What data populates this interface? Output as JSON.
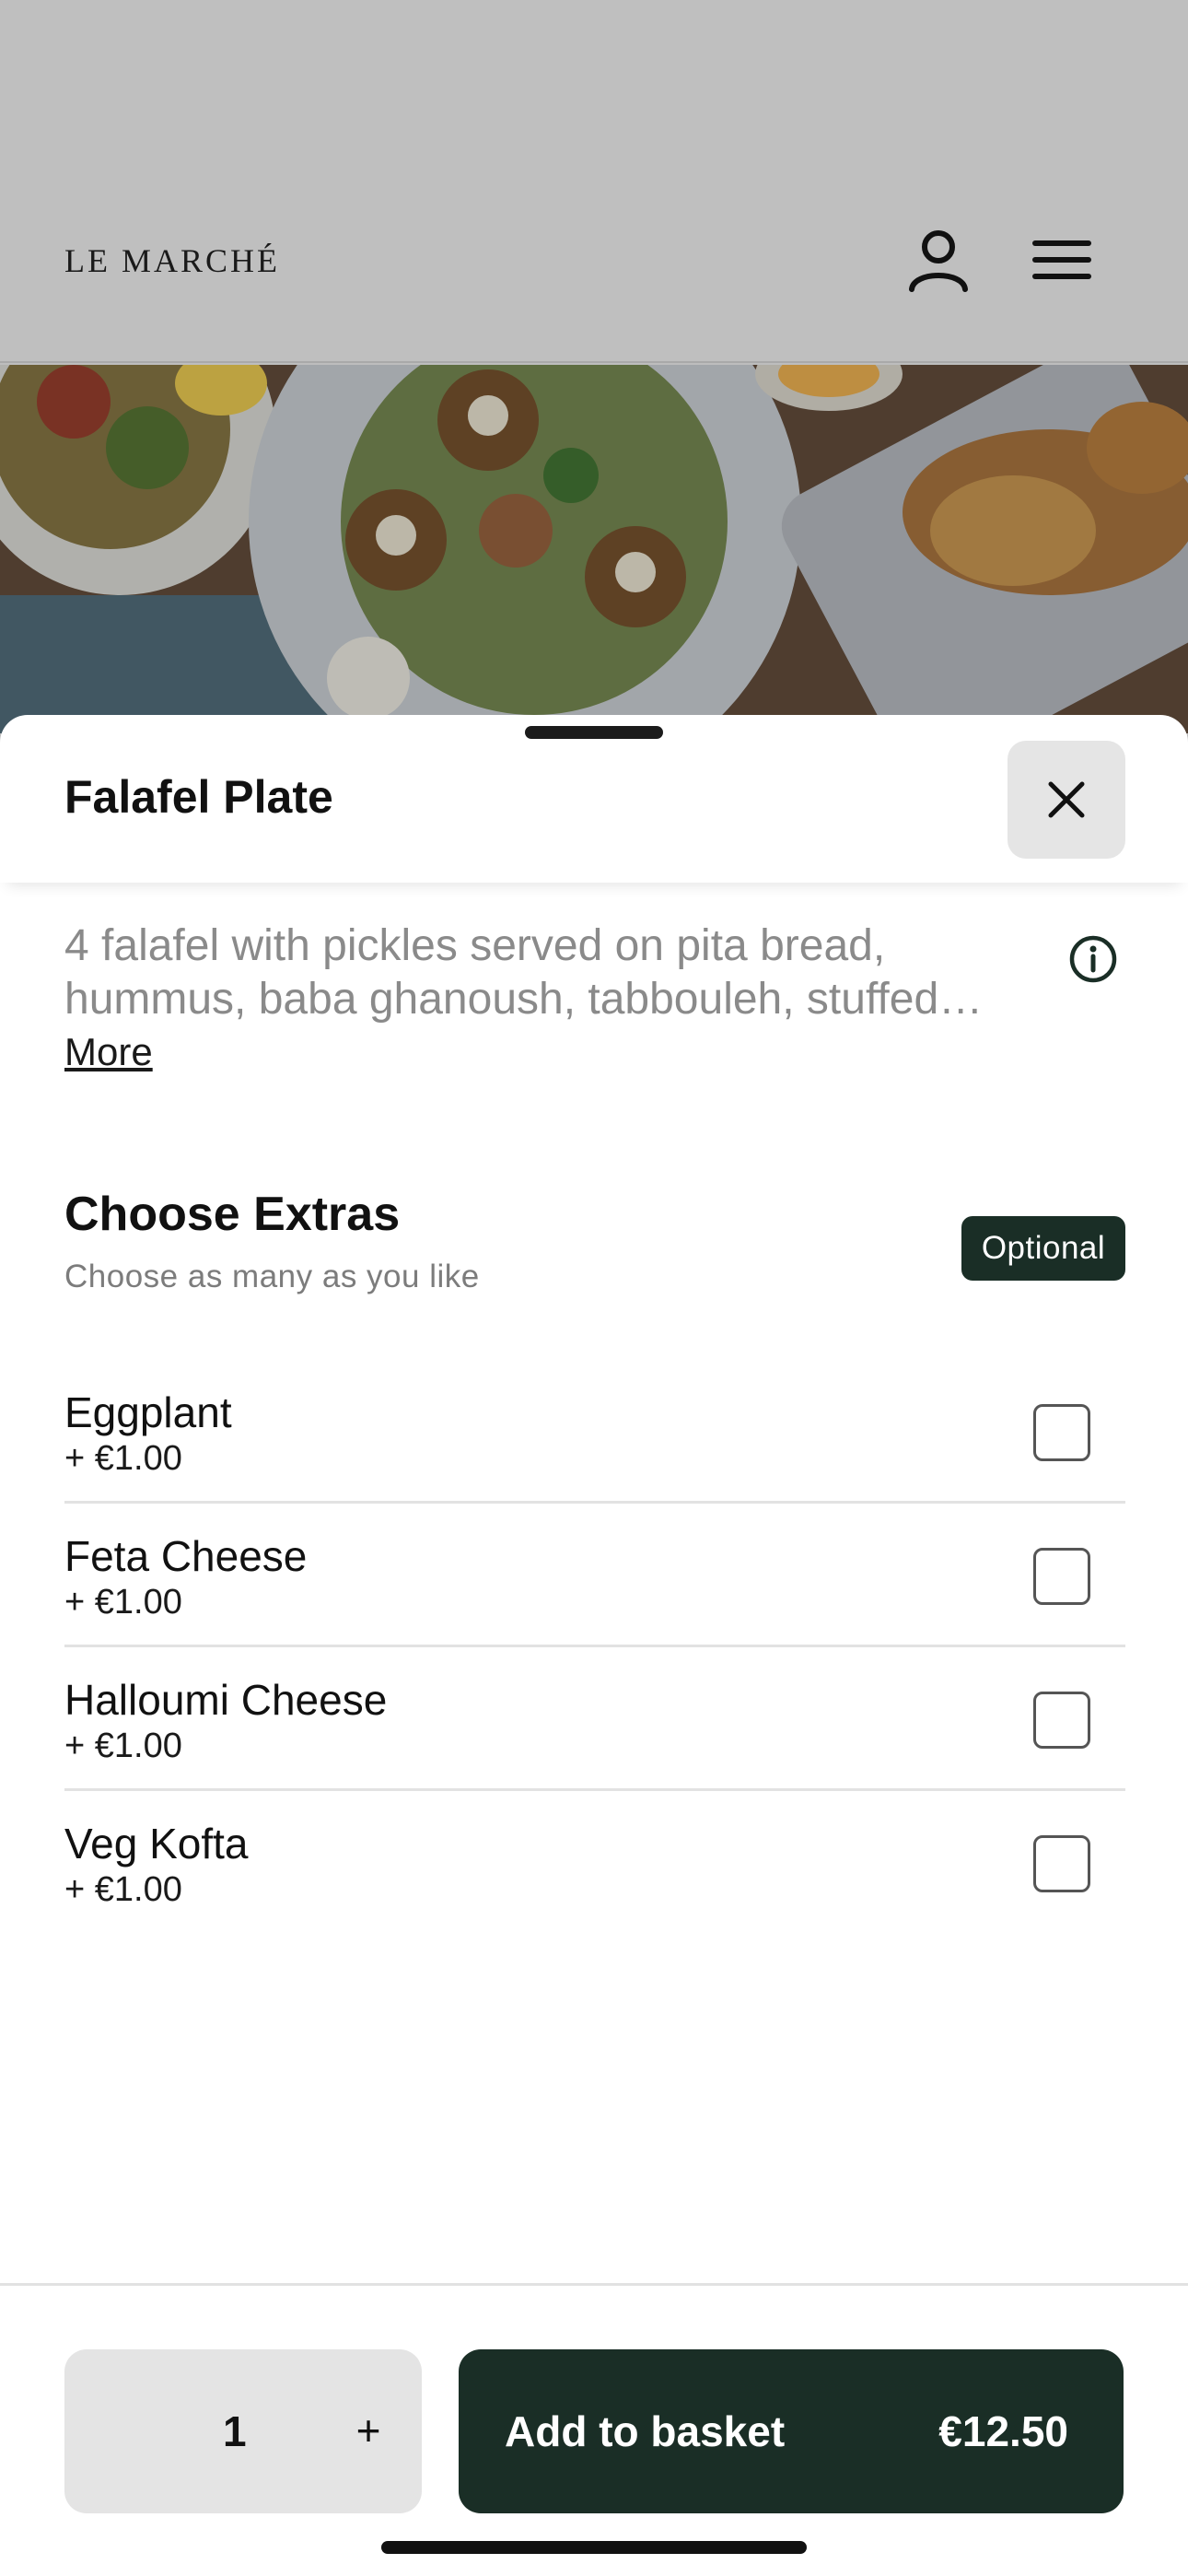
{
  "header": {
    "brand": "LE MARCHÉ",
    "account_icon": "person-icon",
    "menu_icon": "hamburger-menu-icon"
  },
  "hero": {
    "image_description": "food-plates-photo"
  },
  "sheet": {
    "title": "Falafel Plate",
    "close_icon": "close-icon",
    "description": "4 falafel with pickles served on pita bread, hummus, baba ghanoush, tabbouleh, stuffed…",
    "more_label": "More",
    "info_icon": "info-icon"
  },
  "extras": {
    "title": "Choose Extras",
    "subtitle": "Choose as many as you like",
    "badge": "Optional",
    "items": [
      {
        "name": "Eggplant",
        "price": "+ €1.00",
        "checked": false
      },
      {
        "name": "Feta Cheese",
        "price": "+ €1.00",
        "checked": false
      },
      {
        "name": "Halloumi Cheese",
        "price": "+ €1.00",
        "checked": false
      },
      {
        "name": "Veg Kofta",
        "price": "+ €1.00",
        "checked": false
      }
    ]
  },
  "footer": {
    "quantity": "1",
    "increment_label": "+",
    "add_label": "Add to basket",
    "total_price": "€12.50"
  },
  "colors": {
    "brand_dark": "#1a2e26",
    "overlay_gray": "#bfbfbf",
    "muted_text": "#8a8a8a"
  }
}
